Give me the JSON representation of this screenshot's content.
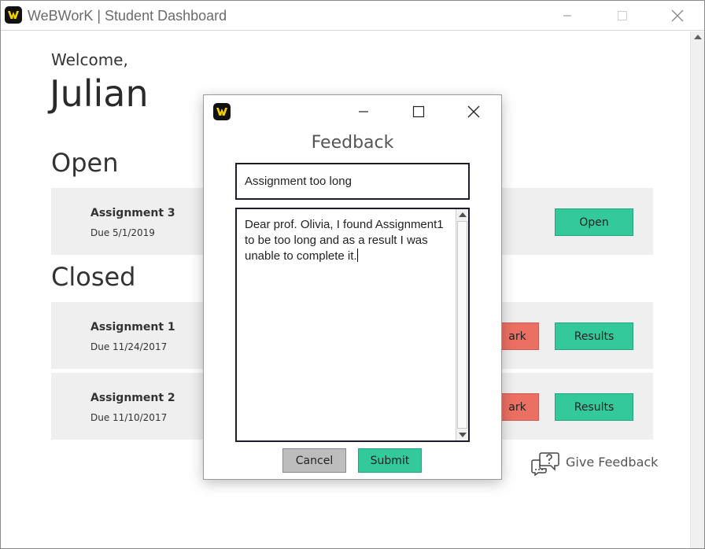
{
  "window": {
    "title": "WeBWorK | Student Dashboard"
  },
  "dashboard": {
    "welcome": "Welcome,",
    "username": "Julian",
    "open_heading": "Open",
    "closed_heading": "Closed",
    "open_assignments": [
      {
        "title": "Assignment 3",
        "due": "Due 5/1/2019",
        "action": "Open"
      }
    ],
    "closed_assignments": [
      {
        "title": "Assignment 1",
        "due": "Due 11/24/2017",
        "secondary_action": "ark",
        "action": "Results"
      },
      {
        "title": "Assignment 2",
        "due": "Due 11/10/2017",
        "secondary_action": "ark",
        "action": "Results"
      }
    ],
    "give_feedback": "Give Feedback"
  },
  "feedback_dialog": {
    "title": "Feedback",
    "subject_value": "Assignment too long",
    "message_value": "Dear prof. Olivia, I found Assignment1 to be too long and as a result I was unable to complete it.",
    "cancel_label": "Cancel",
    "submit_label": "Submit"
  },
  "colors": {
    "accent_green": "#33c99a",
    "accent_red": "#ec6f63",
    "card_background": "#efefef",
    "logo_yellow": "#f5d000"
  },
  "icons": {
    "app": "webwork-logo-icon",
    "feedback": "chat-question-icon"
  }
}
